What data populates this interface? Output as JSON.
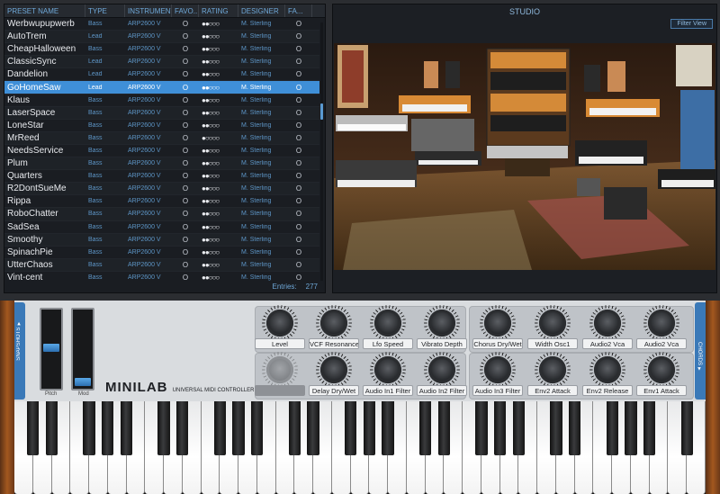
{
  "browser": {
    "columns": [
      "PRESET NAME",
      "TYPE",
      "INSTRUMENT",
      "FAVO...",
      "RATING",
      "DESIGNER",
      "FA..."
    ],
    "rows": [
      {
        "name": "Werbwupupwerb",
        "type": "Bass",
        "instrument": "ARP2600 V",
        "fav": "O",
        "rating": "●●○○○",
        "designer": "M. Sterling",
        "fa": "O"
      },
      {
        "name": "AutoTrem",
        "type": "Lead",
        "instrument": "ARP2600 V",
        "fav": "O",
        "rating": "●●○○○",
        "designer": "M. Sterling",
        "fa": "O"
      },
      {
        "name": "CheapHalloween",
        "type": "Bass",
        "instrument": "ARP2600 V",
        "fav": "O",
        "rating": "●●○○○",
        "designer": "M. Sterling",
        "fa": "O"
      },
      {
        "name": "ClassicSync",
        "type": "Lead",
        "instrument": "ARP2600 V",
        "fav": "O",
        "rating": "●●○○○",
        "designer": "M. Sterling",
        "fa": "O"
      },
      {
        "name": "Dandelion",
        "type": "Lead",
        "instrument": "ARP2600 V",
        "fav": "O",
        "rating": "●●○○○",
        "designer": "M. Sterling",
        "fa": "O"
      },
      {
        "name": "GoHomeSaw",
        "type": "Lead",
        "instrument": "ARP2600 V",
        "fav": "O",
        "rating": "●●○○○",
        "designer": "M. Sterling",
        "fa": "O",
        "selected": true
      },
      {
        "name": "Klaus",
        "type": "Bass",
        "instrument": "ARP2600 V",
        "fav": "O",
        "rating": "●●○○○",
        "designer": "M. Sterling",
        "fa": "O"
      },
      {
        "name": "LaserSpace",
        "type": "Bass",
        "instrument": "ARP2600 V",
        "fav": "O",
        "rating": "●●○○○",
        "designer": "M. Sterling",
        "fa": "O"
      },
      {
        "name": "LoneStar",
        "type": "Bass",
        "instrument": "ARP2600 V",
        "fav": "O",
        "rating": "●●○○○",
        "designer": "M. Sterling",
        "fa": "O"
      },
      {
        "name": "MrReed",
        "type": "Bass",
        "instrument": "ARP2600 V",
        "fav": "O",
        "rating": "●○○○○",
        "designer": "M. Sterling",
        "fa": "O"
      },
      {
        "name": "NeedsService",
        "type": "Bass",
        "instrument": "ARP2600 V",
        "fav": "O",
        "rating": "●●○○○",
        "designer": "M. Sterling",
        "fa": "O"
      },
      {
        "name": "Plum",
        "type": "Bass",
        "instrument": "ARP2600 V",
        "fav": "O",
        "rating": "●●○○○",
        "designer": "M. Sterling",
        "fa": "O"
      },
      {
        "name": "Quarters",
        "type": "Bass",
        "instrument": "ARP2600 V",
        "fav": "O",
        "rating": "●●○○○",
        "designer": "M. Sterling",
        "fa": "O"
      },
      {
        "name": "R2DontSueMe",
        "type": "Bass",
        "instrument": "ARP2600 V",
        "fav": "O",
        "rating": "●●○○○",
        "designer": "M. Sterling",
        "fa": "O"
      },
      {
        "name": "Rippa",
        "type": "Bass",
        "instrument": "ARP2600 V",
        "fav": "O",
        "rating": "●●○○○",
        "designer": "M. Sterling",
        "fa": "O"
      },
      {
        "name": "RoboChatter",
        "type": "Bass",
        "instrument": "ARP2600 V",
        "fav": "O",
        "rating": "●●○○○",
        "designer": "M. Sterling",
        "fa": "O"
      },
      {
        "name": "SadSea",
        "type": "Bass",
        "instrument": "ARP2600 V",
        "fav": "O",
        "rating": "●●○○○",
        "designer": "M. Sterling",
        "fa": "O"
      },
      {
        "name": "Smoothy",
        "type": "Bass",
        "instrument": "ARP2600 V",
        "fav": "O",
        "rating": "●●○○○",
        "designer": "M. Sterling",
        "fa": "O"
      },
      {
        "name": "SpinachPie",
        "type": "Bass",
        "instrument": "ARP2600 V",
        "fav": "O",
        "rating": "●●○○○",
        "designer": "M. Sterling",
        "fa": "O"
      },
      {
        "name": "UtterChaos",
        "type": "Bass",
        "instrument": "ARP2600 V",
        "fav": "O",
        "rating": "●●○○○",
        "designer": "M. Sterling",
        "fa": "O"
      },
      {
        "name": "Vint-cent",
        "type": "Bass",
        "instrument": "ARP2600 V",
        "fav": "O",
        "rating": "●●○○○",
        "designer": "M. Sterling",
        "fa": "O"
      }
    ],
    "entries_label": "Entries:",
    "entries_count": "277"
  },
  "studio": {
    "title": "STUDIO",
    "filter_button": "Filter View"
  },
  "minilab": {
    "snapshots_label": "SNAPSHOTS ▼",
    "chords_label": "CHORDS ▼",
    "pitch_label": "Pitch",
    "mod_label": "Mod",
    "logo_main": "MINILAB",
    "logo_sub": "UNIVERSAL MIDI CONTROLLER",
    "knobs_top": [
      "Level",
      "VCF Resonance",
      "Lfo Speed",
      "Vibrato Depth",
      "Chorus Dry/Wet",
      "Width Osc1",
      "Audio2 Vca",
      "Audio2 Vca"
    ],
    "knobs_bottom": [
      "",
      "Delay Dry/Wet",
      "Audio In1 Filter",
      "Audio In2 Filter",
      "Audio In3 Filter",
      "Env2 Attack",
      "Env2 Release",
      "Env1 Attack"
    ],
    "white_keys": 37
  },
  "colors": {
    "accent": "#3f8fd8",
    "column_text": "#6fa8d8",
    "tab_blue": "#3a79b8"
  }
}
